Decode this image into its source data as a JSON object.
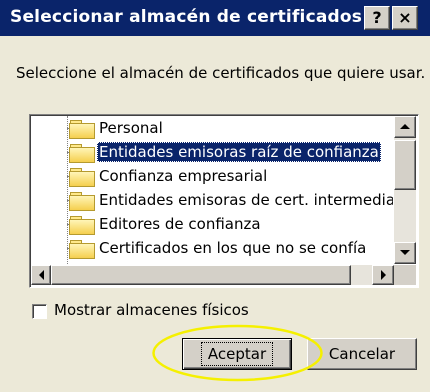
{
  "window": {
    "title": "Seleccionar almacén de certificados",
    "help_label": "?",
    "close_label": "×"
  },
  "prompt": "Seleccione el almacén de certificados que quiere usar.",
  "stores": [
    {
      "label": "Personal",
      "selected": false
    },
    {
      "label": "Entidades emisoras raíz de confianza",
      "selected": true
    },
    {
      "label": "Confianza empresarial",
      "selected": false
    },
    {
      "label": "Entidades emisoras de cert. intermedias",
      "selected": false
    },
    {
      "label": "Editores de confianza",
      "selected": false
    },
    {
      "label": "Certificados en los que no se confía",
      "selected": false
    }
  ],
  "show_physical": {
    "label": "Mostrar almacenes físicos",
    "checked": false
  },
  "buttons": {
    "ok": "Aceptar",
    "cancel": "Cancelar"
  },
  "colors": {
    "titlebar": "#0a246a",
    "dialog_bg": "#ece9d8",
    "highlight_ellipse": "#f5f000"
  }
}
